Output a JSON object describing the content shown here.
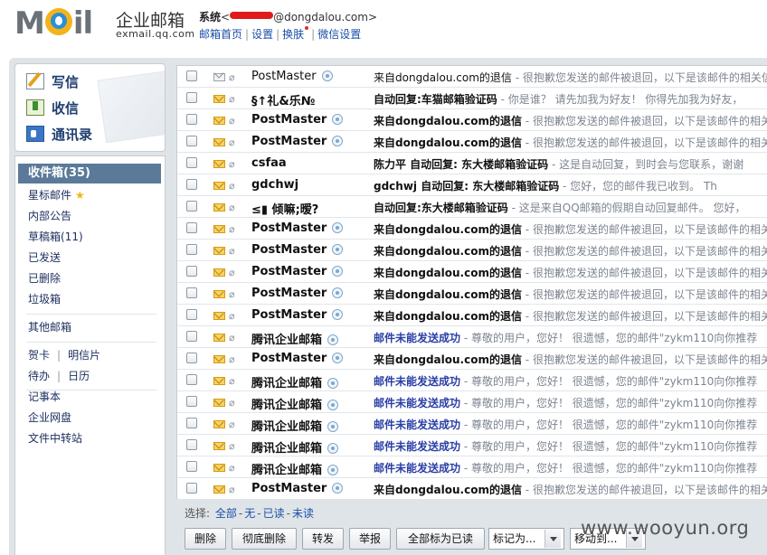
{
  "header": {
    "logo_text": "M",
    "logo_text_end": "il",
    "brand_cn": "企业邮箱",
    "brand_sub": "exmail.qq.com",
    "account_prefix": "系统",
    "account_open": "<",
    "account_domain": "@dongdalou.com>",
    "links": [
      "邮箱首页",
      "设置",
      "换肤",
      "微信设置"
    ]
  },
  "actions": [
    "写信",
    "收信",
    "通讯录"
  ],
  "nav": {
    "inbox": "收件箱(35)",
    "starred": "星标邮件",
    "star_glyph": "★",
    "folders": [
      "内部公告",
      "草稿箱(11)",
      "已发送",
      "已删除",
      "垃圾箱"
    ],
    "other": "其他邮箱",
    "pair1": [
      "贺卡",
      "明信片"
    ],
    "pair2": [
      "待办",
      "日历"
    ],
    "tools": [
      "记事本",
      "企业网盘",
      "文件中转站"
    ]
  },
  "emails": [
    {
      "sender": "PostMaster",
      "verified": true,
      "unread": false,
      "subject": "来自dongdalou.com的退信",
      "preview": " - 很抱歉您发送的邮件被退回，以下是该邮件的相关信息",
      "blue": false
    },
    {
      "sender": "§↑礼&乐№",
      "verified": false,
      "unread": true,
      "subject": "自动回复:车猫邮箱验证码",
      "preview": " - 你是谁？ 请先加我为好友！ 你得先加我为好友，",
      "blue": false
    },
    {
      "sender": "PostMaster",
      "verified": true,
      "unread": true,
      "subject": "来自dongdalou.com的退信",
      "preview": " - 很抱歉您发送的邮件被退回，以下是该邮件的相关",
      "blue": false
    },
    {
      "sender": "PostMaster",
      "verified": true,
      "unread": true,
      "subject": "来自dongdalou.com的退信",
      "preview": " - 很抱歉您发送的邮件被退回，以下是该邮件的相关",
      "blue": false
    },
    {
      "sender": "csfaa",
      "verified": false,
      "unread": true,
      "subject": "陈力平 自动回复: 东大楼邮箱验证码",
      "preview": " -      这是自动回复，到时会与您联系，谢谢",
      "blue": false
    },
    {
      "sender": "gdchwj",
      "verified": false,
      "unread": true,
      "subject": "gdchwj 自动回复: 东大楼邮箱验证码",
      "preview": " -      您好，您的邮件我已收到。      Th",
      "blue": false
    },
    {
      "sender": "≤▮ 倾嘛;暧?",
      "verified": false,
      "unread": true,
      "subject": "自动回复:东大楼邮箱验证码",
      "preview": " - 这是来自QQ邮箱的假期自动回复邮件。    您好，",
      "blue": false
    },
    {
      "sender": "PostMaster",
      "verified": true,
      "unread": true,
      "subject": "来自dongdalou.com的退信",
      "preview": " - 很抱歉您发送的邮件被退回，以下是该邮件的相关",
      "blue": false
    },
    {
      "sender": "PostMaster",
      "verified": true,
      "unread": true,
      "subject": "来自dongdalou.com的退信",
      "preview": " - 很抱歉您发送的邮件被退回，以下是该邮件的相关",
      "blue": false
    },
    {
      "sender": "PostMaster",
      "verified": true,
      "unread": true,
      "subject": "来自dongdalou.com的退信",
      "preview": " - 很抱歉您发送的邮件被退回，以下是该邮件的相关",
      "blue": false
    },
    {
      "sender": "PostMaster",
      "verified": true,
      "unread": true,
      "subject": "来自dongdalou.com的退信",
      "preview": " - 很抱歉您发送的邮件被退回，以下是该邮件的相关",
      "blue": false
    },
    {
      "sender": "PostMaster",
      "verified": true,
      "unread": true,
      "subject": "来自dongdalou.com的退信",
      "preview": " - 很抱歉您发送的邮件被退回，以下是该邮件的相关",
      "blue": false
    },
    {
      "sender": "腾讯企业邮箱",
      "verified": true,
      "unread": true,
      "subject": "邮件未能发送成功",
      "preview": " - 尊敬的用户，您好！ 很遗憾，您的邮件\"zykm110向你推荐",
      "blue": true
    },
    {
      "sender": "PostMaster",
      "verified": true,
      "unread": true,
      "subject": "来自dongdalou.com的退信",
      "preview": " - 很抱歉您发送的邮件被退回，以下是该邮件的相关",
      "blue": false
    },
    {
      "sender": "腾讯企业邮箱",
      "verified": true,
      "unread": true,
      "subject": "邮件未能发送成功",
      "preview": " - 尊敬的用户，您好！ 很遗憾，您的邮件\"zykm110向你推荐",
      "blue": true
    },
    {
      "sender": "腾讯企业邮箱",
      "verified": true,
      "unread": true,
      "subject": "邮件未能发送成功",
      "preview": " - 尊敬的用户，您好！ 很遗憾，您的邮件\"zykm110向你推荐",
      "blue": true
    },
    {
      "sender": "腾讯企业邮箱",
      "verified": true,
      "unread": true,
      "subject": "邮件未能发送成功",
      "preview": " - 尊敬的用户，您好！ 很遗憾，您的邮件\"zykm110向你推荐",
      "blue": true
    },
    {
      "sender": "腾讯企业邮箱",
      "verified": true,
      "unread": true,
      "subject": "邮件未能发送成功",
      "preview": " - 尊敬的用户，您好！ 很遗憾，您的邮件\"zykm110向你推荐",
      "blue": true
    },
    {
      "sender": "腾讯企业邮箱",
      "verified": true,
      "unread": true,
      "subject": "邮件未能发送成功",
      "preview": " - 尊敬的用户，您好！ 很遗憾，您的邮件\"zykm110向你推荐",
      "blue": true
    },
    {
      "sender": "PostMaster",
      "verified": true,
      "unread": true,
      "subject": "来自dongdalou.com的退信",
      "preview": " - 很抱歉您发送的邮件被退回，以下是该邮件的相关",
      "blue": false
    }
  ],
  "select_bar": {
    "label": "选择:",
    "options": [
      "全部",
      "无",
      "已读",
      "未读"
    ]
  },
  "buttons": [
    "删除",
    "彻底删除",
    "转发",
    "举报",
    "全部标为已读"
  ],
  "dropdowns": [
    "标记为...",
    "移动到..."
  ],
  "watermark": "www.wooyun.org",
  "colors": {
    "active_nav": "#5b7a99",
    "link": "#1a4fa8",
    "subject_blue": "#2a3fa6",
    "frame": "#dfe4e8"
  }
}
